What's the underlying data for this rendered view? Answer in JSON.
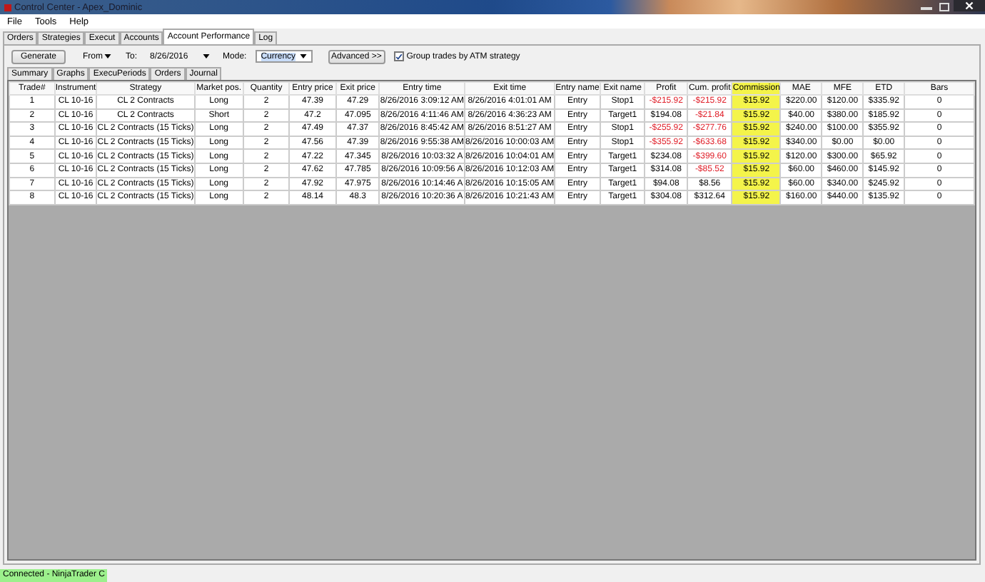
{
  "window": {
    "title": "Control Center - Apex_Dominic"
  },
  "menu": [
    "File",
    "Tools",
    "Help"
  ],
  "tabs": [
    {
      "label": "Orders",
      "selected": false
    },
    {
      "label": "Strategies",
      "selected": false
    },
    {
      "label": "Execut",
      "selected": false
    },
    {
      "label": "Accounts",
      "selected": false
    },
    {
      "label": "Account Performance",
      "selected": true
    },
    {
      "label": "Log",
      "selected": false
    }
  ],
  "toolbar": {
    "generate": "Generate",
    "from": "From",
    "to_label": "To:",
    "to_value": "8/26/2016",
    "mode_label": "Mode:",
    "mode_value": "Currency",
    "advanced": "Advanced >>",
    "group_trades": {
      "label": "Group trades by ATM strategy",
      "checked": true
    }
  },
  "subtabs": [
    {
      "label": "Summary",
      "selected": false
    },
    {
      "label": "Graphs",
      "selected": false
    },
    {
      "label": "ExecuPeriods",
      "selected": false
    },
    {
      "label": "Orders",
      "selected": false
    },
    {
      "label": "Journal",
      "selected": false
    }
  ],
  "table": {
    "columns": [
      {
        "label": "Trade#",
        "highlighted": false
      },
      {
        "label": "Instrument",
        "highlighted": false
      },
      {
        "label": "Strategy",
        "highlighted": false
      },
      {
        "label": "Market pos.",
        "highlighted": false
      },
      {
        "label": "Quantity",
        "highlighted": false
      },
      {
        "label": "Entry price",
        "highlighted": false
      },
      {
        "label": "Exit price",
        "highlighted": false
      },
      {
        "label": "Entry time",
        "highlighted": false
      },
      {
        "label": "Exit time",
        "highlighted": false
      },
      {
        "label": "Entry name",
        "highlighted": false
      },
      {
        "label": "Exit name",
        "highlighted": false
      },
      {
        "label": "Profit",
        "highlighted": false
      },
      {
        "label": "Cum. profit",
        "highlighted": false
      },
      {
        "label": "Commission",
        "highlighted": true
      },
      {
        "label": "MAE",
        "highlighted": false
      },
      {
        "label": "MFE",
        "highlighted": false
      },
      {
        "label": "ETD",
        "highlighted": false
      },
      {
        "label": "Bars",
        "highlighted": false
      }
    ],
    "rows": [
      {
        "cells": [
          "1",
          "CL 10-16",
          "CL 2 Contracts",
          "Long",
          "2",
          "47.39",
          "47.29",
          "8/26/2016 3:09:12 AM",
          "8/26/2016 4:01:01 AM",
          "Entry",
          "Stop1",
          {
            "text": "-$215.92",
            "negative": true
          },
          {
            "text": "-$215.92",
            "negative": true
          },
          "$15.92",
          "$220.00",
          "$120.00",
          "$335.92",
          "0"
        ]
      },
      {
        "cells": [
          "2",
          "CL 10-16",
          "CL 2 Contracts",
          "Short",
          "2",
          "47.2",
          "47.095",
          "8/26/2016 4:11:46 AM",
          "8/26/2016 4:36:23 AM",
          "Entry",
          "Target1",
          "$194.08",
          {
            "text": "-$21.84",
            "negative": true
          },
          "$15.92",
          "$40.00",
          "$380.00",
          "$185.92",
          "0"
        ]
      },
      {
        "cells": [
          "3",
          "CL 10-16",
          "CL 2 Contracts (15 Ticks)",
          "Long",
          "2",
          "47.49",
          "47.37",
          "8/26/2016 8:45:42 AM",
          "8/26/2016 8:51:27 AM",
          "Entry",
          "Stop1",
          {
            "text": "-$255.92",
            "negative": true
          },
          {
            "text": "-$277.76",
            "negative": true
          },
          "$15.92",
          "$240.00",
          "$100.00",
          "$355.92",
          "0"
        ]
      },
      {
        "cells": [
          "4",
          "CL 10-16",
          "CL 2 Contracts (15 Ticks)",
          "Long",
          "2",
          "47.56",
          "47.39",
          "8/26/2016 9:55:38 AM",
          "8/26/2016 10:00:03 AM",
          "Entry",
          "Stop1",
          {
            "text": "-$355.92",
            "negative": true
          },
          {
            "text": "-$633.68",
            "negative": true
          },
          "$15.92",
          "$340.00",
          "$0.00",
          "$0.00",
          "0"
        ]
      },
      {
        "cells": [
          "5",
          "CL 10-16",
          "CL 2 Contracts (15 Ticks)",
          "Long",
          "2",
          "47.22",
          "47.345",
          "8/26/2016 10:03:32 A",
          "8/26/2016 10:04:01 AM",
          "Entry",
          "Target1",
          "$234.08",
          {
            "text": "-$399.60",
            "negative": true
          },
          "$15.92",
          "$120.00",
          "$300.00",
          "$65.92",
          "0"
        ]
      },
      {
        "cells": [
          "6",
          "CL 10-16",
          "CL 2 Contracts (15 Ticks)",
          "Long",
          "2",
          "47.62",
          "47.785",
          "8/26/2016 10:09:56 A",
          "8/26/2016 10:12:03 AM",
          "Entry",
          "Target1",
          "$314.08",
          {
            "text": "-$85.52",
            "negative": true
          },
          "$15.92",
          "$60.00",
          "$460.00",
          "$145.92",
          "0"
        ]
      },
      {
        "cells": [
          "7",
          "CL 10-16",
          "CL 2 Contracts (15 Ticks)",
          "Long",
          "2",
          "47.92",
          "47.975",
          "8/26/2016 10:14:46 A",
          "8/26/2016 10:15:05 AM",
          "Entry",
          "Target1",
          "$94.08",
          "$8.56",
          "$15.92",
          "$60.00",
          "$340.00",
          "$245.92",
          "0"
        ]
      },
      {
        "cells": [
          "8",
          "CL 10-16",
          "CL 2 Contracts (15 Ticks)",
          "Long",
          "2",
          "48.14",
          "48.3",
          "8/26/2016 10:20:36 A",
          "8/26/2016 10:21:43 AM",
          "Entry",
          "Target1",
          "$304.08",
          "$312.64",
          "$15.92",
          "$160.00",
          "$440.00",
          "$135.92",
          "0"
        ]
      }
    ]
  },
  "status_bar": {
    "text": "Connected - NinjaTrader C"
  }
}
